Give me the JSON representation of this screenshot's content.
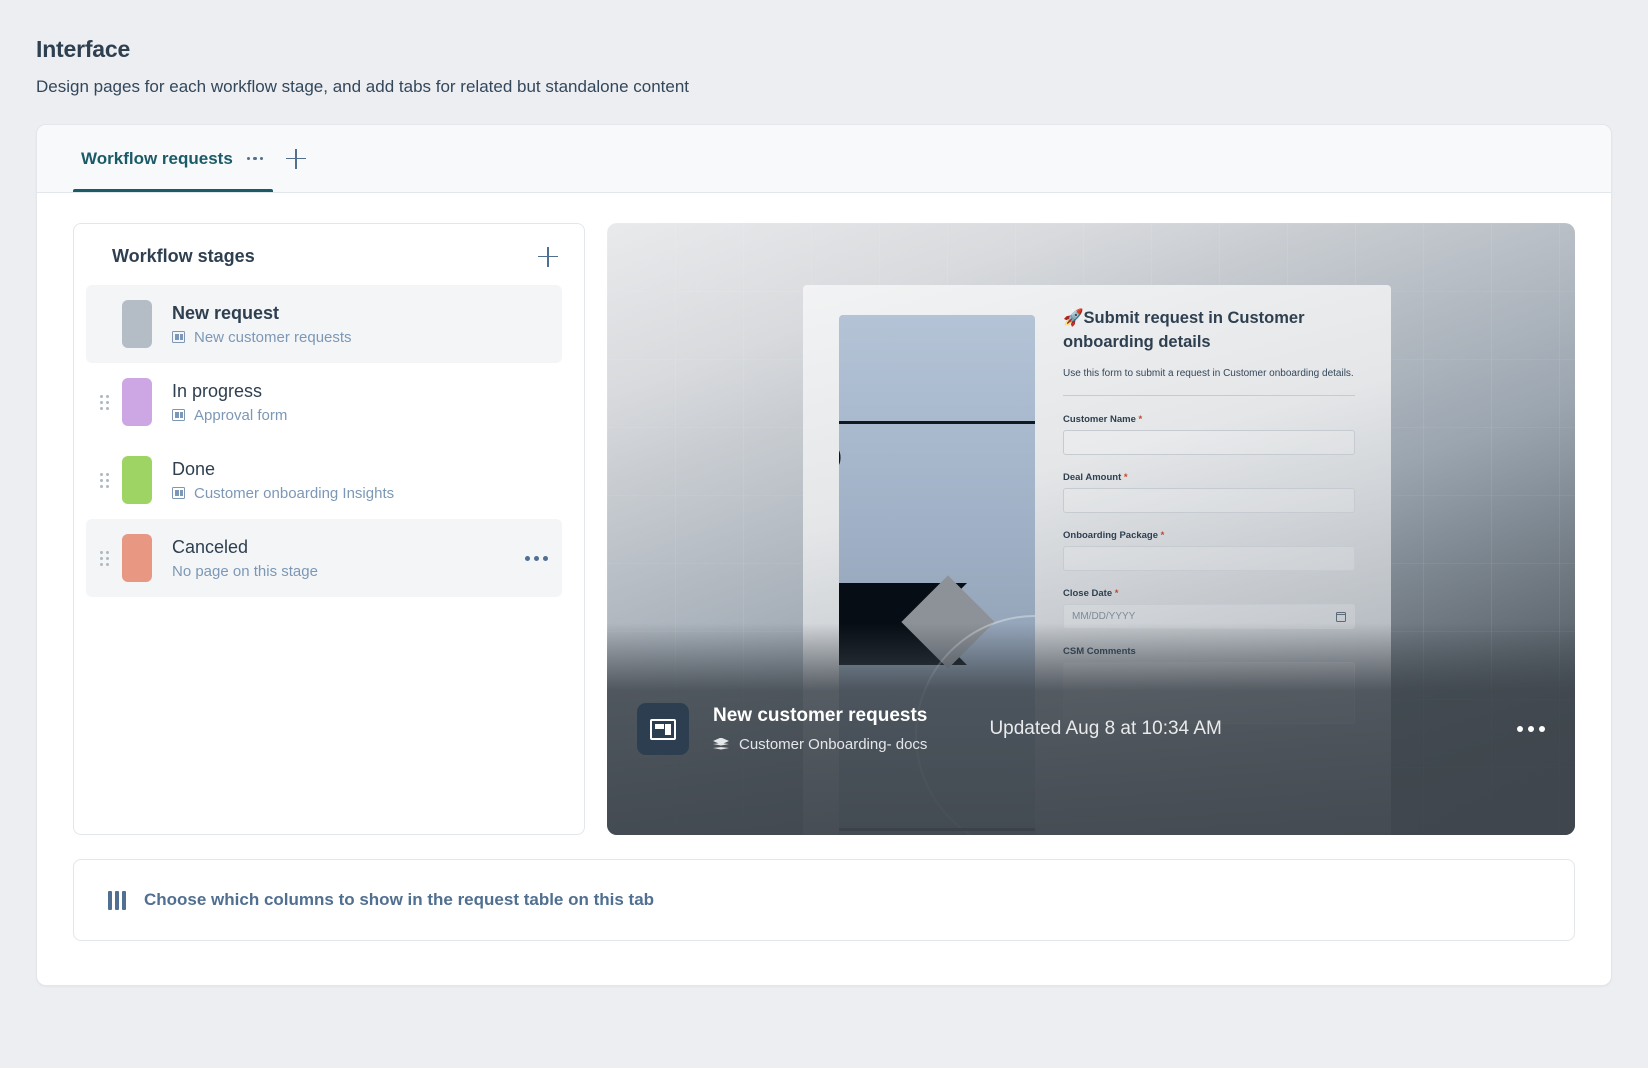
{
  "header": {
    "title": "Interface",
    "subtitle": "Design pages for each workflow stage, and add tabs for related but standalone content"
  },
  "tabs": {
    "items": [
      {
        "label": "Workflow requests",
        "active": true,
        "menu_icon": "ellipsis-icon"
      }
    ],
    "add_icon": "plus-icon"
  },
  "stages_panel": {
    "title": "Workflow stages",
    "add_icon": "plus-icon",
    "stages": [
      {
        "name": "New request",
        "page": "New customer requests",
        "color": "#b4bcc5",
        "highlight": true,
        "draggable": false,
        "page_icon": "page-layout-icon"
      },
      {
        "name": "In progress",
        "page": "Approval form",
        "color": "#cda7e3",
        "highlight": false,
        "draggable": true,
        "page_icon": "page-layout-icon"
      },
      {
        "name": "Done",
        "page": "Customer onboarding Insights",
        "color": "#9ed463",
        "highlight": false,
        "draggable": true,
        "page_icon": "page-layout-icon"
      },
      {
        "name": "Canceled",
        "page": "No page on this stage",
        "color": "#e89782",
        "highlight": true,
        "draggable": true,
        "has_menu": true,
        "menu_icon": "ellipsis-icon",
        "page_icon": null
      }
    ]
  },
  "preview": {
    "form": {
      "title": "🚀Submit request in Customer onboarding details",
      "description": "Use this form to submit a request in Customer onboarding details.",
      "fields": [
        {
          "label": "Customer Name",
          "required": true,
          "value": "",
          "type": "text"
        },
        {
          "label": "Deal Amount",
          "required": true,
          "value": "",
          "type": "text"
        },
        {
          "label": "Onboarding Package",
          "required": true,
          "value": "",
          "type": "text"
        },
        {
          "label": "Close Date",
          "required": true,
          "value": "",
          "placeholder": "MM/DD/YYYY",
          "type": "date"
        },
        {
          "label": "CSM Comments",
          "required": false,
          "value": "",
          "type": "textarea"
        }
      ]
    },
    "overlay": {
      "icon": "page-layout-icon",
      "title": "New customer requests",
      "source_icon": "layers-icon",
      "source": "Customer Onboarding- docs",
      "updated": "Updated Aug 8 at 10:34 AM",
      "menu_icon": "ellipsis-icon"
    }
  },
  "columns_bar": {
    "icon": "columns-icon",
    "label": "Choose which columns to show in the request table on this tab"
  }
}
